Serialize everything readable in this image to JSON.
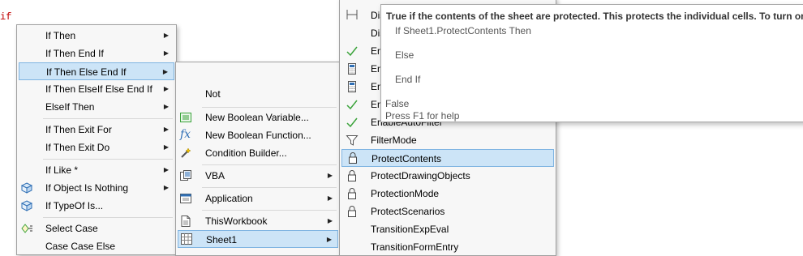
{
  "editor": {
    "keyword": "if"
  },
  "menu1": {
    "items": [
      {
        "label": "If Then",
        "has_sub": true
      },
      {
        "label": "If Then End If",
        "has_sub": true
      },
      {
        "label": "If Then Else End If",
        "has_sub": true,
        "selected": true
      },
      {
        "label": "If Then ElseIf Else End If",
        "has_sub": true
      },
      {
        "label": "ElseIf Then",
        "has_sub": true
      },
      {
        "label": "If Then Exit For",
        "has_sub": true
      },
      {
        "label": "If Then Exit Do",
        "has_sub": true
      },
      {
        "label": "If Like *",
        "has_sub": true
      },
      {
        "label": "If Object Is Nothing",
        "has_sub": true
      },
      {
        "label": "If TypeOf Is...",
        "has_sub": false
      },
      {
        "label": "Select Case",
        "has_sub": false
      },
      {
        "label": "Case Case Else",
        "has_sub": false
      }
    ]
  },
  "menu2": {
    "items": [
      {
        "label": "Not",
        "has_sub": false
      },
      {
        "label": "New Boolean Variable...",
        "has_sub": false
      },
      {
        "label": "New Boolean Function...",
        "has_sub": false
      },
      {
        "label": "Condition Builder...",
        "has_sub": false
      },
      {
        "label": "VBA",
        "has_sub": true
      },
      {
        "label": "Application",
        "has_sub": true
      },
      {
        "label": "ThisWorkbook",
        "has_sub": true
      },
      {
        "label": "Sheet1",
        "has_sub": true,
        "selected": true
      }
    ]
  },
  "menu3": {
    "partial": [
      "Dis",
      "Dis",
      "En",
      "En",
      "En",
      "En"
    ],
    "enable_partial": "EnableAutoFilter",
    "items": [
      {
        "label": "FilterMode"
      },
      {
        "label": "ProtectContents",
        "selected": true
      },
      {
        "label": "ProtectDrawingObjects"
      },
      {
        "label": "ProtectionMode"
      },
      {
        "label": "ProtectScenarios"
      },
      {
        "label": "TransitionExpEval"
      },
      {
        "label": "TransitionFormEntry"
      }
    ]
  },
  "tooltip": {
    "title": "True if the contents of the sheet are protected. This protects the individual cells. To turn on c",
    "code1": "If Sheet1.ProtectContents Then",
    "code2": "Else",
    "code3": "End If",
    "type": "False",
    "help": "Press F1 for help"
  },
  "colors": {
    "selection": "#cce4f7",
    "selection_border": "#7fb4e2",
    "check": "#3aa33a",
    "icon_blue": "#2f6fb5",
    "keyword_red": "#c00000"
  }
}
